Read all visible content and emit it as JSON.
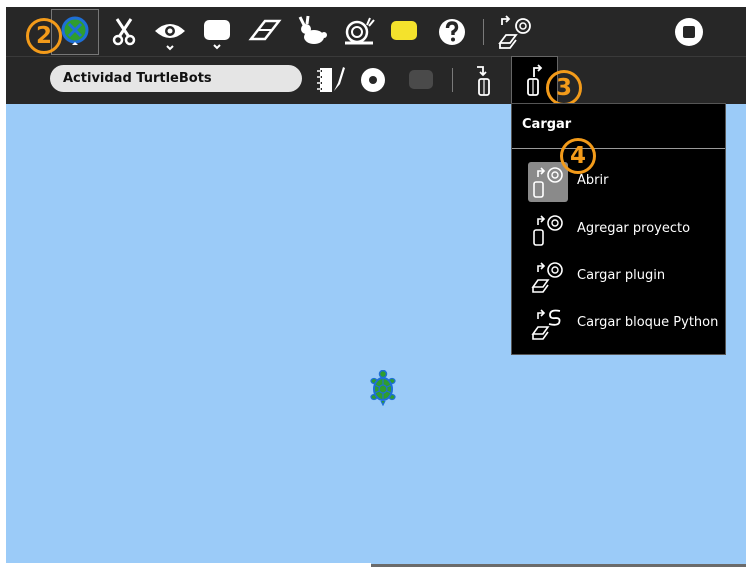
{
  "activity_title": "Actividad TurtleBots",
  "badges": {
    "b2": "2",
    "b3": "3",
    "b4": "4"
  },
  "menu": {
    "title": "Cargar",
    "items": [
      {
        "label": "Abrir",
        "icon": "open-icon",
        "selected": true
      },
      {
        "label": "Agregar proyecto",
        "icon": "add-project-icon",
        "selected": false
      },
      {
        "label": "Cargar plugin",
        "icon": "load-plugin-icon",
        "selected": false
      },
      {
        "label": "Cargar bloque Python",
        "icon": "load-python-block-icon",
        "selected": false
      }
    ]
  },
  "colors": {
    "canvas": "#9bcbf8",
    "toolbar": "#272727",
    "badge": "#f39b1a",
    "turtle": "#2f9d2f"
  }
}
